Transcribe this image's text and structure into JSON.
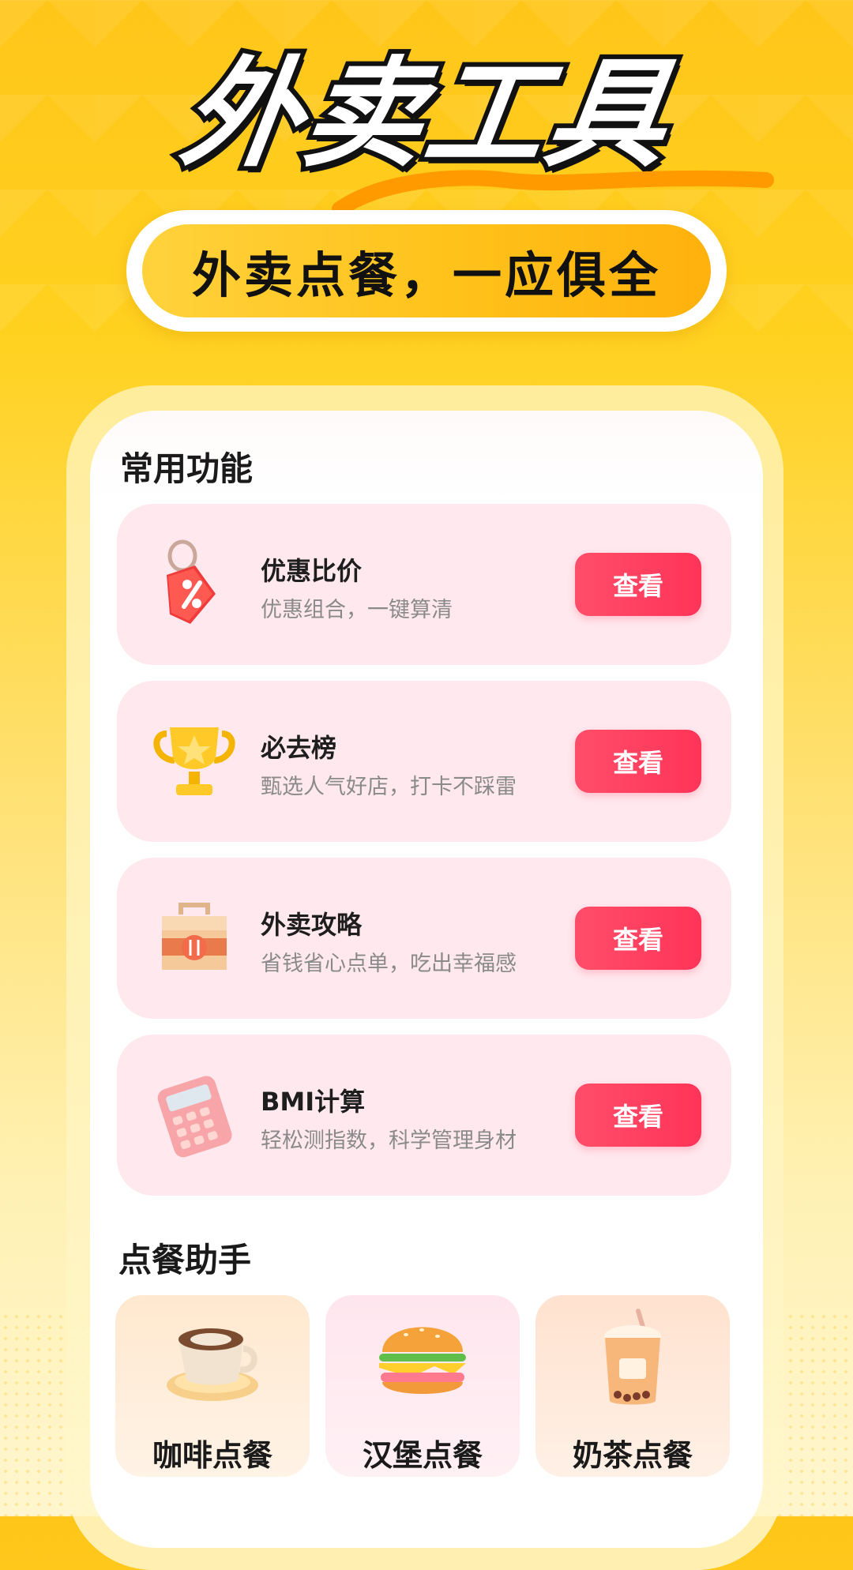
{
  "hero": {
    "title": "外卖工具",
    "slogan": "外卖点餐，一应俱全"
  },
  "common_section": {
    "title": "常用功能",
    "items": [
      {
        "name": "优惠比价",
        "desc": "优惠组合，一键算清",
        "button": "查看",
        "icon": "discount-tag-icon"
      },
      {
        "name": "必去榜",
        "desc": "甄选人气好店，打卡不踩雷",
        "button": "查看",
        "icon": "trophy-icon"
      },
      {
        "name": "外卖攻略",
        "desc": "省钱省心点单，吃出幸福感",
        "button": "查看",
        "icon": "takeout-bag-icon"
      },
      {
        "name": "BMI计算",
        "desc": "轻松测指数，科学管理身材",
        "button": "查看",
        "icon": "calculator-icon"
      }
    ]
  },
  "helper_section": {
    "title": "点餐助手",
    "items": [
      {
        "label": "咖啡点餐",
        "icon": "coffee-cup-icon"
      },
      {
        "label": "汉堡点餐",
        "icon": "burger-icon"
      },
      {
        "label": "奶茶点餐",
        "icon": "milk-tea-icon"
      }
    ]
  },
  "colors": {
    "accent": "#ff3d5f",
    "card_bg": "#ffe9ef",
    "brand_yellow": "#ffc61a"
  }
}
